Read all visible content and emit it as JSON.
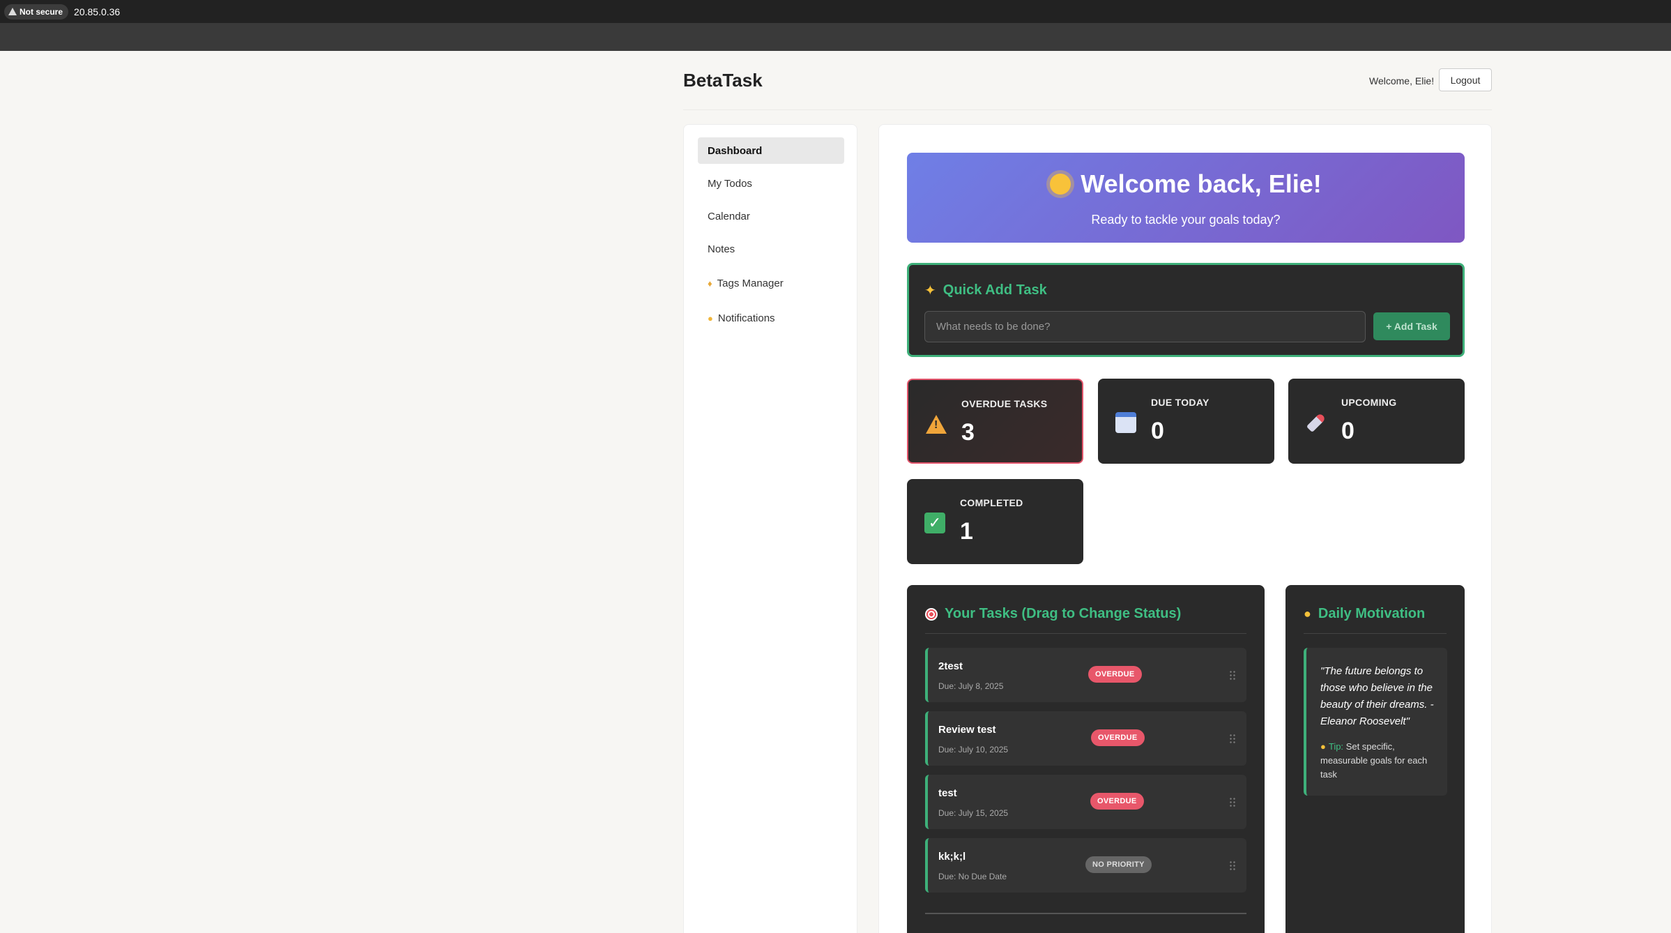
{
  "browser": {
    "security_label": "Not secure",
    "url": "20.85.0.36"
  },
  "header": {
    "brand": "BetaTask",
    "welcome_text": "Welcome, Elie!",
    "logout_label": "Logout"
  },
  "sidebar": {
    "items": [
      {
        "label": "Dashboard",
        "active": true,
        "icon": ""
      },
      {
        "label": "My Todos",
        "active": false,
        "icon": ""
      },
      {
        "label": "Calendar",
        "active": false,
        "icon": ""
      },
      {
        "label": "Notes",
        "active": false,
        "icon": ""
      },
      {
        "label": "Tags Manager",
        "active": false,
        "icon": "tag-icon"
      },
      {
        "label": "Notifications",
        "active": false,
        "icon": "bell-icon"
      }
    ]
  },
  "hero": {
    "title": "Welcome back, Elie!",
    "subtitle": "Ready to tackle your goals today?",
    "icon": "sun-icon"
  },
  "quick_add": {
    "title": "Quick Add Task",
    "placeholder": "What needs to be done?",
    "button_label": "+ Add Task"
  },
  "stats": [
    {
      "label": "OVERDUE TASKS",
      "value": "3",
      "icon": "warning-icon"
    },
    {
      "label": "DUE TODAY",
      "value": "0",
      "icon": "calendar-icon"
    },
    {
      "label": "UPCOMING",
      "value": "0",
      "icon": "rocket-icon"
    },
    {
      "label": "COMPLETED",
      "value": "1",
      "icon": "checkmark-icon"
    }
  ],
  "tasks": {
    "title": "Your Tasks (Drag to Change Status)",
    "items": [
      {
        "name": "2test",
        "due": "Due: July 8, 2025",
        "badge": "OVERDUE"
      },
      {
        "name": "Review test",
        "due": "Due: July 10, 2025",
        "badge": "OVERDUE"
      },
      {
        "name": "test",
        "due": "Due: July 15, 2025",
        "badge": "OVERDUE"
      },
      {
        "name": "kk;k;l",
        "due": "Due: No Due Date",
        "badge": "NO PRIORITY"
      }
    ]
  },
  "motivation": {
    "title": "Daily Motivation",
    "quote": "\"The future belongs to those who believe in the beauty of their dreams. - Eleanor Roosevelt\"",
    "tip_label": "Tip:",
    "tip_text": "Set specific, measurable goals for each task"
  },
  "colors": {
    "accent_green": "#3fbe83",
    "overdue_red": "#e8576a",
    "hero_gradient_start": "#6f7fe6",
    "hero_gradient_end": "#7f57c2"
  }
}
